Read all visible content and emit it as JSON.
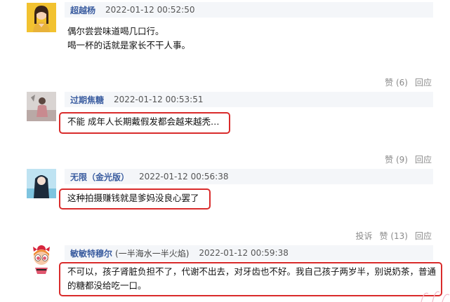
{
  "comments": [
    {
      "username": "超越杨",
      "username_suffix": "",
      "time": "2022-01-12 00:52:50",
      "lines": [
        "偶尔尝尝味道喝几口行。",
        "喝一杯的话就是家长不干人事。"
      ],
      "actions": {
        "report": "",
        "like": "赞 (6)",
        "reply": "回应"
      }
    },
    {
      "username": "过期焦糖",
      "username_suffix": "",
      "time": "2022-01-12 00:53:51",
      "lines": [
        "不能 成年人长期戴假发都会越来越秃…"
      ],
      "actions": {
        "report": "",
        "like": "赞 (9)",
        "reply": "回应"
      }
    },
    {
      "username": "无限（金光版）",
      "username_suffix": "",
      "time": "2022-01-12 00:56:38",
      "lines": [
        "这种拍摄赚钱就是爹妈没良心罢了"
      ],
      "actions": {
        "report": "投诉",
        "like": "赞 (13)",
        "reply": "回应"
      }
    },
    {
      "username": "敏敏特穆尔",
      "username_suffix": "(一半海水一半火焰)",
      "time": "2022-01-12 00:59:38",
      "lines": [
        "不可以，孩子肾脏负担不了，代谢不出去，对牙齿也不好。我自己孩子两岁半，别说奶茶，普通的糖都没给吃一口。"
      ],
      "actions": {
        "report": "",
        "like": "",
        "reply": ""
      }
    }
  ],
  "colors": {
    "username": "#3b5da0",
    "highlight_border": "#d92b2b",
    "meta_bg": "#f4f6f9",
    "action_text": "#8a8a8a"
  },
  "icons": [
    "avatar-girl-icon",
    "avatar-photo-icon",
    "avatar-anime-icon",
    "avatar-powerpuff-icon"
  ]
}
